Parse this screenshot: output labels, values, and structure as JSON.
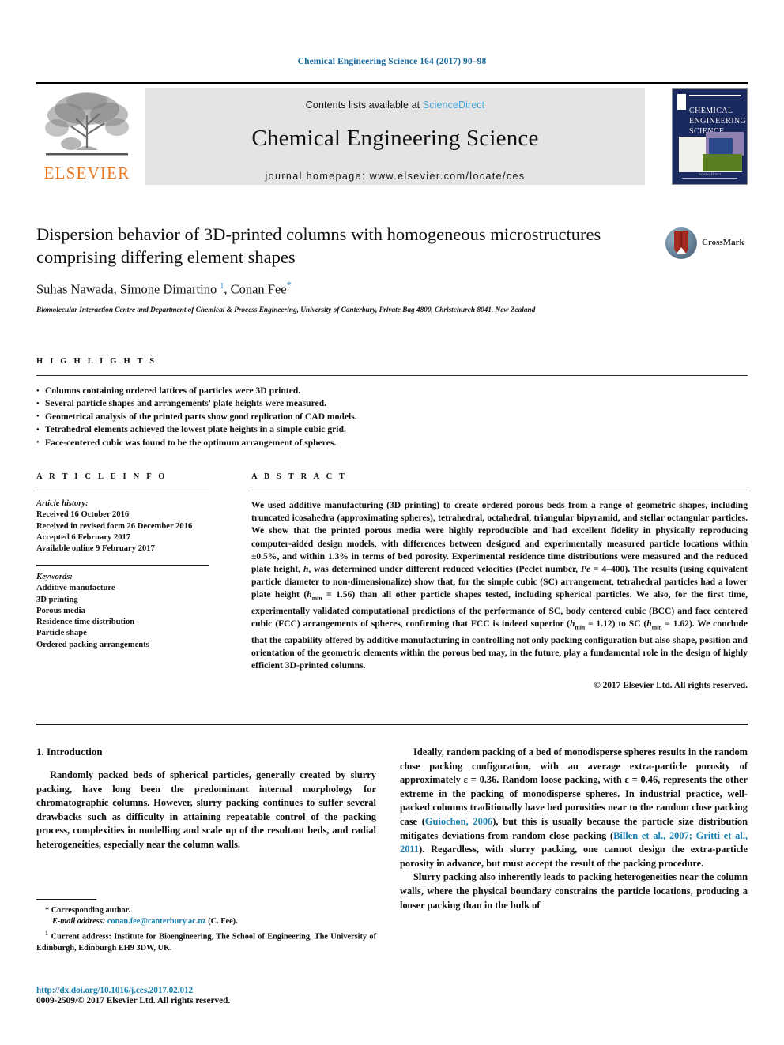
{
  "running_head": "Chemical Engineering Science 164 (2017) 90–98",
  "masthead": {
    "contents_prefix": "Contents lists available at ",
    "sciencedirect": "ScienceDirect",
    "journal_title": "Chemical Engineering Science",
    "homepage": "journal homepage: www.elsevier.com/locate/ces",
    "publisher_logo_text": "ELSEVIER",
    "cover": {
      "line1": "CHEMICAL",
      "line2": "ENGINEERING",
      "line3": "SCIENCE",
      "footer": "ScienceDirect"
    }
  },
  "article": {
    "title": "Dispersion behavior of 3D-printed columns with homogeneous microstructures comprising differing element shapes",
    "authors_html": "Suhas Nawada, Simone Dimartino <sup class=\"sup-num\">1</sup>, Conan Fee<sup class=\"sup-star\">*</sup>",
    "affiliation": "Biomolecular Interaction Centre and Department of Chemical & Process Engineering, University of Canterbury, Private Bag 4800, Christchurch 8041, New Zealand",
    "crossmark_label": "CrossMark"
  },
  "highlights": {
    "label": "H I G H L I G H T S",
    "items": [
      "Columns containing ordered lattices of particles were 3D printed.",
      "Several particle shapes and arrangements' plate heights were measured.",
      "Geometrical analysis of the printed parts show good replication of CAD models.",
      "Tetrahedral elements achieved the lowest plate heights in a simple cubic grid.",
      "Face-centered cubic was found to be the optimum arrangement of spheres."
    ]
  },
  "article_info": {
    "label": "A R T I C L E   I N F O",
    "history_label": "Article history:",
    "history": [
      "Received 16 October 2016",
      "Received in revised form 26 December 2016",
      "Accepted 6 February 2017",
      "Available online 9 February 2017"
    ],
    "keywords_label": "Keywords:",
    "keywords": [
      "Additive manufacture",
      "3D printing",
      "Porous media",
      "Residence time distribution",
      "Particle shape",
      "Ordered packing arrangements"
    ]
  },
  "abstract": {
    "label": "A B S T R A C T",
    "text_html": "We used additive manufacturing (3D printing) to create ordered porous beds from a range of geometric shapes, including truncated icosahedra (approximating spheres), tetrahedral, octahedral, triangular bipyramid, and stellar octangular particles. We show that the printed porous media were highly reproducible and had excellent fidelity in physically reproducing computer-aided design models, with differences between designed and experimentally measured particle locations within ±0.5%, and within 1.3% in terms of bed porosity. Experimental residence time distributions were measured and the reduced plate height, <i>h</i>, was determined under different reduced velocities (Peclet number, <i>Pe</i> = 4–400). The results (using equivalent particle diameter to non-dimensionalize) show that, for the simple cubic (SC) arrangement, tetrahedral particles had a lower plate height (<i>h</i><sub>min</sub> = 1.56) than all other particle shapes tested, including spherical particles. We also, for the first time, experimentally validated computational predictions of the performance of SC, body centered cubic (BCC) and face centered cubic (FCC) arrangements of spheres, confirming that FCC is indeed superior (<i>h</i><sub>min</sub> = 1.12) to SC (<i>h</i><sub>min</sub> = 1.62). We conclude that the capability offered by additive manufacturing in controlling not only packing configuration but also shape, position and orientation of the geometric elements within the porous bed may, in the future, play a fundamental role in the design of highly efficient 3D-printed columns.",
    "copyright": "© 2017 Elsevier Ltd. All rights reserved."
  },
  "body": {
    "section_heading": "1. Introduction",
    "left_paragraphs_html": [
      "Randomly packed beds of spherical particles, generally created by slurry packing, have long been the predominant internal morphology for chromatographic columns. However, slurry packing continues to suffer several drawbacks such as difficulty in attaining repeatable control of the packing process, complexities in modelling and scale up of the resultant beds, and radial heterogeneities, especially near the column walls."
    ],
    "right_paragraphs_html": [
      "Ideally, random packing of a bed of monodisperse spheres results in the random close packing configuration, with an average extra-particle porosity of approximately &#949; = 0.36. Random loose packing, with &#949; = 0.46, represents the other extreme in the packing of monodisperse spheres. In industrial practice, well-packed columns traditionally have bed porosities near to the random close packing case (<span class=\"cite\">Guiochon, 2006</span>), but this is usually because the particle size distribution mitigates deviations from random close packing (<span class=\"cite\">Billen et al., 2007; Gritti et al., 2011</span>). Regardless, with slurry packing, one cannot design the extra-particle porosity in advance, but must accept the result of the packing procedure.",
      "Slurry packing also inherently leads to packing heterogeneities near the column walls, where the physical boundary constrains the particle locations, producing a looser packing than in the bulk of"
    ]
  },
  "footnotes": {
    "corresponding": "* Corresponding author.",
    "email_label": "E-mail address:",
    "email": "conan.fee@canterbury.ac.nz",
    "email_suffix": "(C. Fee).",
    "current_address": "Current address: Institute for Bioengineering, The School of Engineering, The University of Edinburgh, Edinburgh EH9 3DW, UK.",
    "current_address_marker": "1"
  },
  "doi": {
    "url": "http://dx.doi.org/10.1016/j.ces.2017.02.012",
    "issn_line": "0009-2509/© 2017 Elsevier Ltd. All rights reserved."
  },
  "colors": {
    "link": "#1a7fae",
    "sciencedirect": "#49a3d6",
    "elsevier_orange": "#e87722",
    "running_head": "#1a6a9e",
    "band_gray": "#e4e4e4",
    "cover_navy": "#1b2a5e"
  }
}
